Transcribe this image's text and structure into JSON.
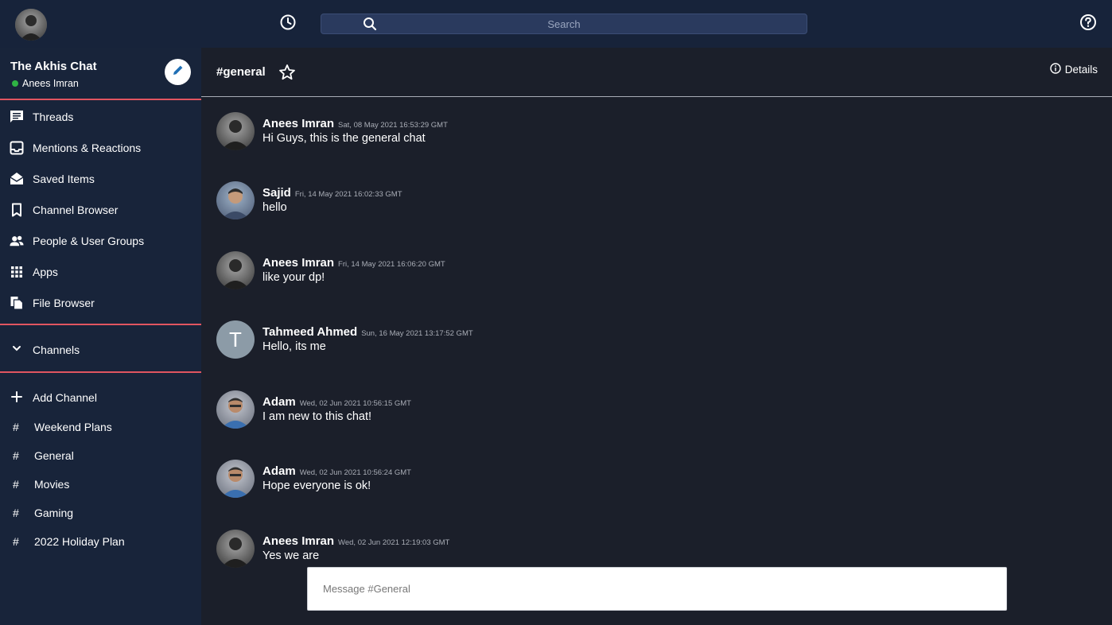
{
  "topbar": {
    "search_placeholder": "Search",
    "icons": {
      "history": "clock-icon",
      "search": "search-icon",
      "help": "help-circle-icon"
    }
  },
  "workspace": {
    "name": "The Akhis Chat",
    "user": "Anees Imran",
    "status_color": "#2fb344"
  },
  "nav": {
    "items": [
      {
        "label": "Threads",
        "icon": "threads-icon"
      },
      {
        "label": "Mentions & Reactions",
        "icon": "inbox-icon"
      },
      {
        "label": "Saved Items",
        "icon": "envelope-open-icon"
      },
      {
        "label": "Channel Browser",
        "icon": "bookmark-icon"
      },
      {
        "label": "People & User Groups",
        "icon": "people-icon"
      },
      {
        "label": "Apps",
        "icon": "apps-grid-icon"
      },
      {
        "label": "File Browser",
        "icon": "files-icon"
      }
    ]
  },
  "channels": {
    "section_label": "Channels",
    "add_label": "Add Channel",
    "hash": "#",
    "items": [
      {
        "label": "Weekend Plans"
      },
      {
        "label": "General"
      },
      {
        "label": "Movies"
      },
      {
        "label": "Gaming"
      },
      {
        "label": "2022 Holiday Plan"
      }
    ]
  },
  "channel_header": {
    "title": "#general",
    "details_label": "Details"
  },
  "messages": [
    {
      "author": "Anees Imran",
      "time": "Sat, 08 May 2021 16:53:29 GMT",
      "text": "Hi Guys, this is the general chat",
      "avatar": "photo-anees"
    },
    {
      "author": "Sajid",
      "time": "Fri, 14 May 2021 16:02:33 GMT",
      "text": "hello",
      "avatar": "photo-sajid"
    },
    {
      "author": "Anees Imran",
      "time": "Fri, 14 May 2021 16:06:20 GMT",
      "text": "like your dp!",
      "avatar": "photo-anees"
    },
    {
      "author": "Tahmeed Ahmed",
      "time": "Sun, 16 May 2021 13:17:52 GMT",
      "text": "Hello, its me",
      "avatar_letter": "T"
    },
    {
      "author": "Adam",
      "time": "Wed, 02 Jun 2021 10:56:15 GMT",
      "text": "I am new to this chat!",
      "avatar": "photo-adam"
    },
    {
      "author": "Adam",
      "time": "Wed, 02 Jun 2021 10:56:24 GMT",
      "text": "Hope everyone is ok!",
      "avatar": "photo-adam"
    },
    {
      "author": "Anees Imran",
      "time": "Wed, 02 Jun 2021 12:19:03 GMT",
      "text": "Yes we are",
      "avatar": "photo-anees"
    }
  ],
  "composer": {
    "placeholder": "Message #General"
  },
  "colors": {
    "topbar_bg": "#17233a",
    "sidebar_bg": "#18243a",
    "main_bg": "#1b1f2a",
    "divider_accent": "#e15560",
    "search_bg": "#2a3a5e"
  }
}
